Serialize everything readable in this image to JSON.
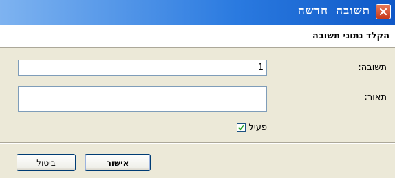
{
  "window": {
    "title": "תשובה חדשה"
  },
  "header": {
    "text": "הקלד נתוני תשובה"
  },
  "form": {
    "reply_label": "תשובה:",
    "reply_value": "1",
    "description_label": "תאור:",
    "description_value": "",
    "active_label": "פעיל",
    "active_checked": true
  },
  "buttons": {
    "ok_label": "אישור",
    "cancel_label": "ביטול"
  }
}
